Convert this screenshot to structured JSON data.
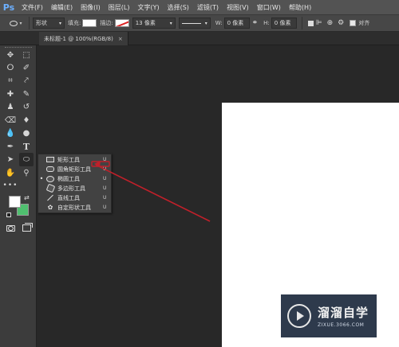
{
  "app": {
    "logo": "Ps",
    "menu": [
      "文件(F)",
      "编辑(E)",
      "图像(I)",
      "图层(L)",
      "文字(Y)",
      "选择(S)",
      "滤镜(T)",
      "视图(V)",
      "窗口(W)",
      "帮助(H)"
    ]
  },
  "options": {
    "shape_mode": "形状",
    "fill_label": "填充:",
    "stroke_label": "描边:",
    "stroke_width": "13 像素",
    "width_label": "W:",
    "width_value": "0 像素",
    "height_label": "H:",
    "height_value": "0 像素",
    "align_edges": "对齐"
  },
  "document": {
    "tab_title": "未标题-1 @ 100%(RGB/8)",
    "close": "×"
  },
  "flyout": {
    "items": [
      {
        "label": "矩形工具",
        "key": "U",
        "icon": "rectangle-tool-icon",
        "active": false
      },
      {
        "label": "圆角矩形工具",
        "key": "U",
        "icon": "rounded-rectangle-tool-icon",
        "active": false
      },
      {
        "label": "椭圆工具",
        "key": "U",
        "icon": "ellipse-tool-icon",
        "active": true
      },
      {
        "label": "多边形工具",
        "key": "U",
        "icon": "polygon-tool-icon",
        "active": false
      },
      {
        "label": "直线工具",
        "key": "U",
        "icon": "line-tool-icon",
        "active": false
      },
      {
        "label": "自定形状工具",
        "key": "U",
        "icon": "custom-shape-tool-icon",
        "active": false
      }
    ],
    "active_marker": "•"
  },
  "colors": {
    "foreground": "#ffffff",
    "background": "#4fbf6f",
    "annotation_arrow": "#c0202a"
  },
  "watermark": {
    "name": "溜溜自学",
    "url": "ZIXUE.3066.COM"
  }
}
